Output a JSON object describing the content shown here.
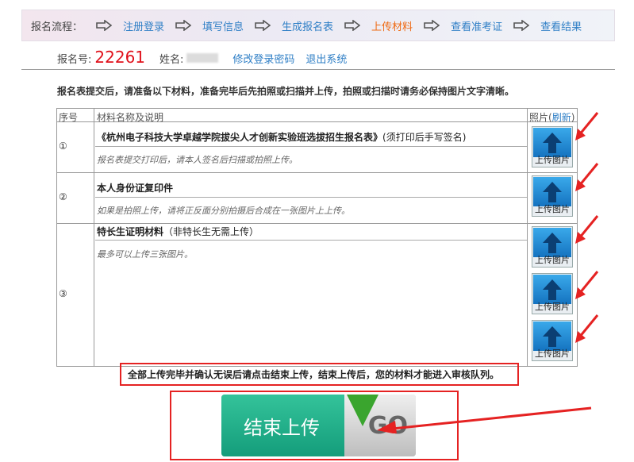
{
  "steps": {
    "label": "报名流程：",
    "items": [
      {
        "label": "注册登录",
        "active": false
      },
      {
        "label": "填写信息",
        "active": false
      },
      {
        "label": "生成报名表",
        "active": false
      },
      {
        "label": "上传材料",
        "active": true
      },
      {
        "label": "查看准考证",
        "active": false
      },
      {
        "label": "查看结果",
        "active": false
      }
    ]
  },
  "info": {
    "reg_label": "报名号:",
    "reg_no": "22261",
    "name_label": "姓名:",
    "links": [
      "修改登录密码",
      "退出系统"
    ]
  },
  "notice": "报名表提交后，请准备以下材料，准备完毕后先拍照或扫描并上传，拍照或扫描时请务必保持图片文字清晰。",
  "table": {
    "headers": {
      "no": "序号",
      "name": "材料名称及说明",
      "photo": "照片(",
      "refresh": "刷新",
      "photo_end": ")"
    },
    "rows": [
      {
        "no": "①",
        "title": "《杭州电子科技大学卓越学院拔尖人才创新实验班选拔招生报名表》",
        "note": "(须打印后手写签名)",
        "hint": "报名表提交打印后，请本人签名后扫描或拍照上传。"
      },
      {
        "no": "②",
        "title": "本人身份证复印件",
        "note": "",
        "hint": "如果是拍照上传，请将正反面分别拍摄后合成在一张图片上上传。"
      },
      {
        "no": "③",
        "title": "特长生证明材料",
        "note": "（非特长生无需上传）",
        "hint": "最多可以上传三张图片。"
      }
    ],
    "upload_label": "上传图片"
  },
  "bottom": {
    "note": "全部上传完毕并确认无误后请点击结束上传，结束上传后，您的材料才能进入审核队列。",
    "end_label": "结束上传",
    "go": "GO"
  },
  "colors": {
    "link": "#2f7fc6",
    "active": "#ef6a14",
    "accent_red": "#e52222",
    "green": "#149d7b"
  }
}
